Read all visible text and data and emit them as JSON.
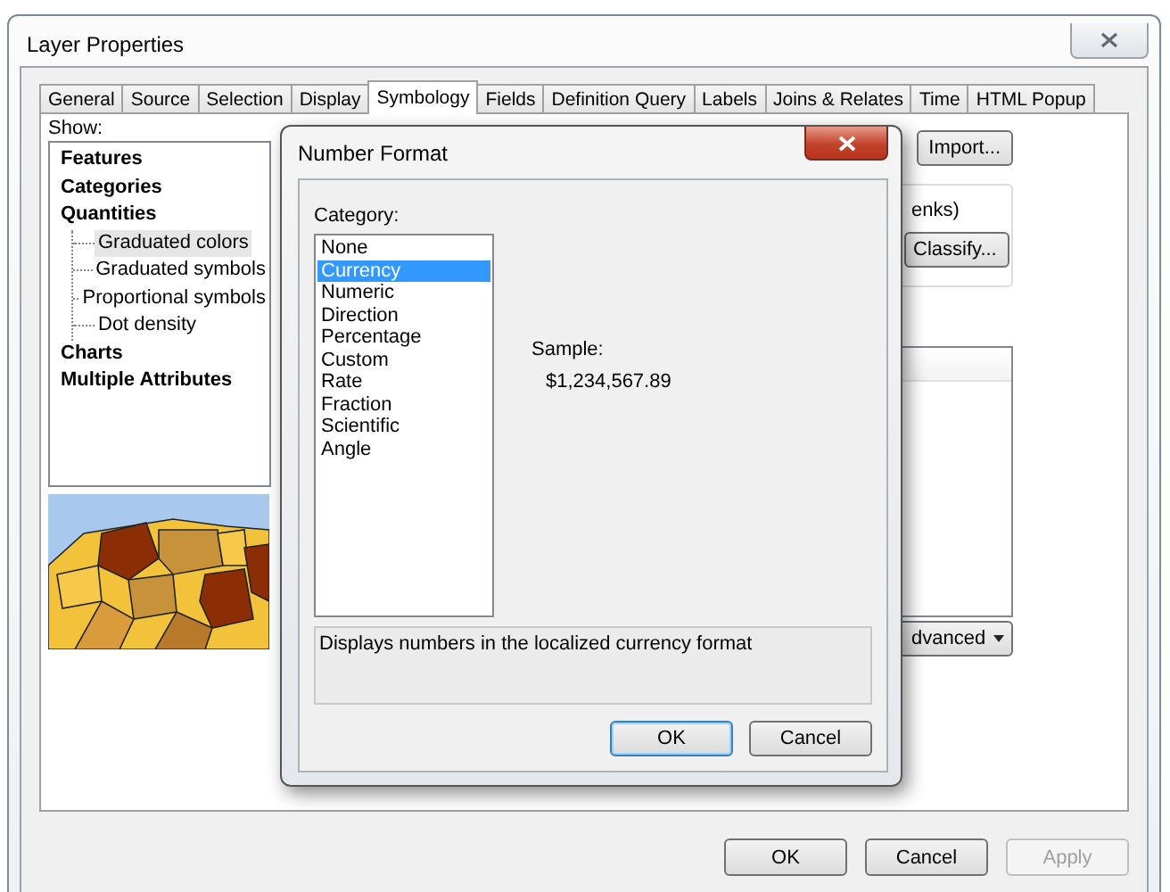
{
  "window": {
    "title": "Layer Properties"
  },
  "tabs": [
    {
      "label": "General",
      "selected": false
    },
    {
      "label": "Source",
      "selected": false
    },
    {
      "label": "Selection",
      "selected": false
    },
    {
      "label": "Display",
      "selected": false
    },
    {
      "label": "Symbology",
      "selected": true
    },
    {
      "label": "Fields",
      "selected": false
    },
    {
      "label": "Definition Query",
      "selected": false
    },
    {
      "label": "Labels",
      "selected": false
    },
    {
      "label": "Joins & Relates",
      "selected": false
    },
    {
      "label": "Time",
      "selected": false
    },
    {
      "label": "HTML Popup",
      "selected": false
    }
  ],
  "show": {
    "label": "Show:",
    "tree": [
      {
        "label": "Features",
        "selected": false
      },
      {
        "label": "Categories",
        "selected": false
      },
      {
        "label": "Quantities",
        "selected": false,
        "children": [
          {
            "label": "Graduated colors",
            "selected": true
          },
          {
            "label": "Graduated symbols",
            "selected": false
          },
          {
            "label": "Proportional symbols",
            "selected": false
          },
          {
            "label": "Dot density",
            "selected": false
          }
        ]
      },
      {
        "label": "Charts",
        "selected": false
      },
      {
        "label": "Multiple Attributes",
        "selected": false
      }
    ]
  },
  "symbology": {
    "import_button": "Import...",
    "classification_text": "enks)",
    "classify_button": "Classify...",
    "advanced_dropdown": "dvanced"
  },
  "footer_buttons": [
    {
      "label": "OK",
      "disabled": false
    },
    {
      "label": "Cancel",
      "disabled": false
    },
    {
      "label": "Apply",
      "disabled": true
    }
  ],
  "dialog": {
    "title": "Number Format",
    "category_label": "Category:",
    "categories": [
      {
        "label": "None",
        "selected": false
      },
      {
        "label": "Currency",
        "selected": true
      },
      {
        "label": "Numeric",
        "selected": false
      },
      {
        "label": "Direction",
        "selected": false
      },
      {
        "label": "Percentage",
        "selected": false
      },
      {
        "label": "Custom",
        "selected": false
      },
      {
        "label": "Rate",
        "selected": false
      },
      {
        "label": "Fraction",
        "selected": false
      },
      {
        "label": "Scientific",
        "selected": false
      },
      {
        "label": "Angle",
        "selected": false
      }
    ],
    "sample_label": "Sample:",
    "sample_value": "$1,234,567.89",
    "description": "Displays numbers in the localized currency format",
    "buttons": [
      {
        "label": "OK",
        "default": true
      },
      {
        "label": "Cancel",
        "default": false
      }
    ]
  }
}
